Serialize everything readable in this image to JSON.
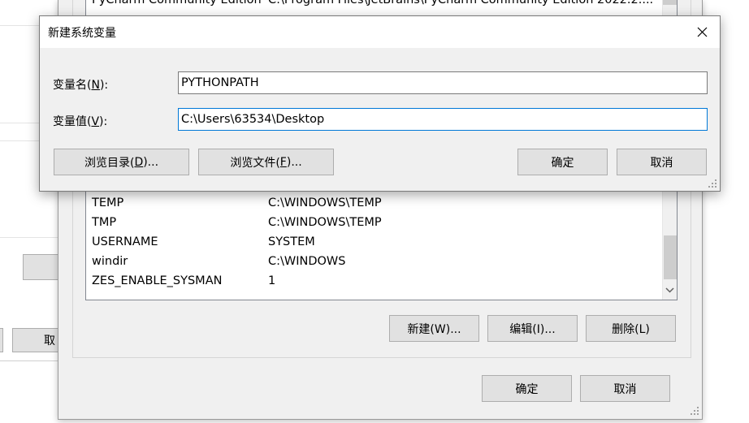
{
  "top_partial_row": {
    "name": "PyCharm Community Edition",
    "value": "C:\\Program Files\\JetBrains\\PyCharm Community Edition 2022.2...."
  },
  "env_rows": [
    {
      "name": "TEMP",
      "value": "C:\\WINDOWS\\TEMP"
    },
    {
      "name": "TMP",
      "value": "C:\\WINDOWS\\TEMP"
    },
    {
      "name": "USERNAME",
      "value": "SYSTEM"
    },
    {
      "name": "windir",
      "value": "C:\\WINDOWS"
    },
    {
      "name": "ZES_ENABLE_SYSMAN",
      "value": "1"
    }
  ],
  "env_buttons": {
    "new": "新建(W)...",
    "edit": "编辑(I)...",
    "delete": "删除(L)",
    "ok": "确定",
    "cancel": "取消"
  },
  "bg_window": {
    "cancel_partial": "取"
  },
  "dialog": {
    "title": "新建系统变量",
    "name_label_prefix": "变量名(",
    "name_label_key": "N",
    "name_label_suffix": "):",
    "name_value": "PYTHONPATH",
    "value_label_prefix": "变量值(",
    "value_label_key": "V",
    "value_label_suffix": "):",
    "value_value": "C:\\Users\\63534\\Desktop",
    "browse_dir_prefix": "浏览目录(",
    "browse_dir_key": "D",
    "browse_dir_suffix": ")...",
    "browse_file_prefix": "浏览文件(",
    "browse_file_key": "F",
    "browse_file_suffix": ")...",
    "ok": "确定",
    "cancel": "取消"
  }
}
